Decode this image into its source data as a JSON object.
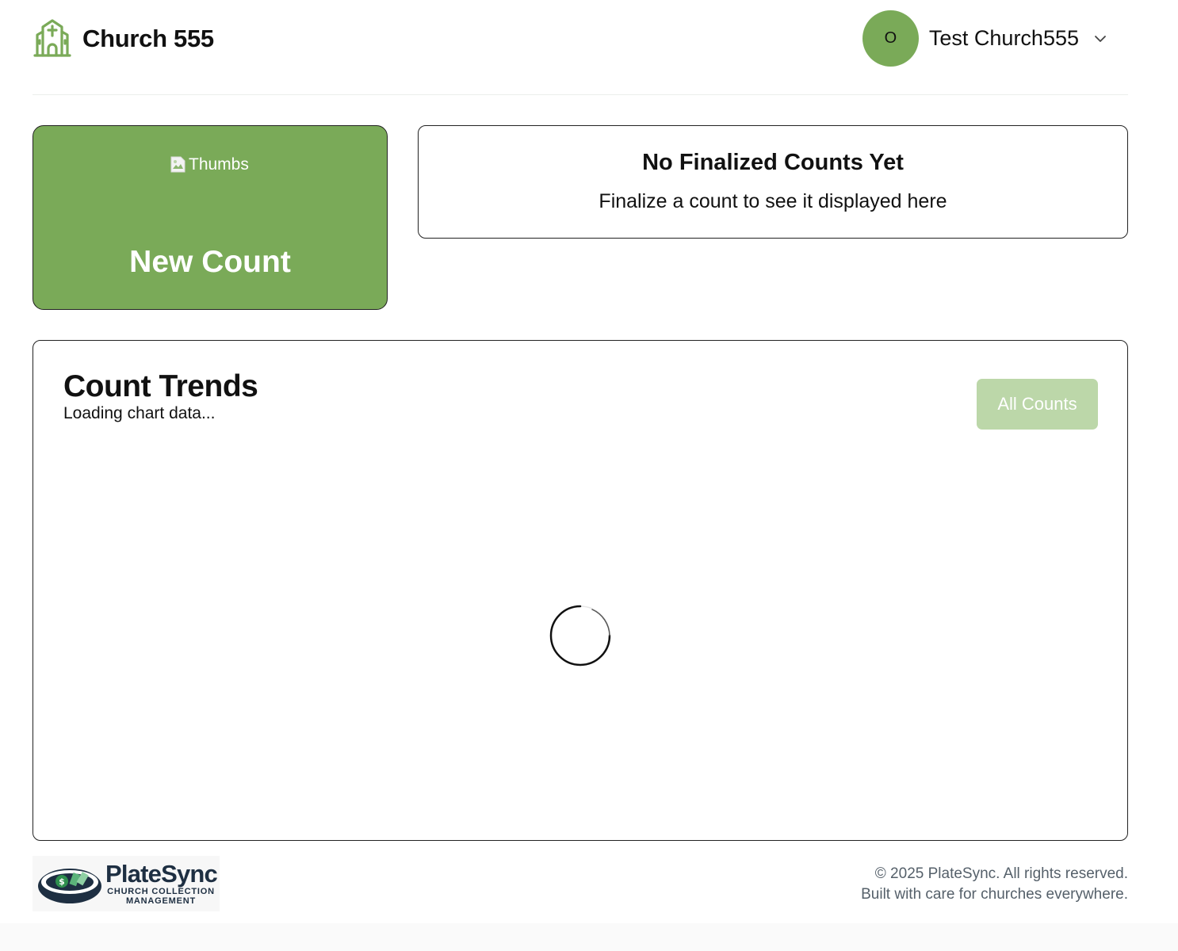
{
  "header": {
    "brand_title": "Church 555",
    "brand_icon": "church-icon",
    "user_initial": "O",
    "user_name": "Test Church555",
    "menu_icon": "chevron-down-icon"
  },
  "new_count_card": {
    "image_alt": "Thumbs",
    "label": "New Count"
  },
  "finalized_card": {
    "title": "No Finalized Counts Yet",
    "subtitle": "Finalize a count to see it displayed here"
  },
  "trends": {
    "title": "Count Trends",
    "status": "Loading chart data...",
    "all_counts_button": "All Counts",
    "spinner_icon": "loading-spinner-icon"
  },
  "footer": {
    "logo_name": "PlateSync",
    "logo_tagline_1": "CHURCH COLLECTION",
    "logo_tagline_2": "MANAGEMENT",
    "copyright": "© 2025 PlateSync. All rights reserved.",
    "tagline": "Built with care for churches everywhere."
  },
  "colors": {
    "brand_green": "#7aaa58",
    "button_disabled_green": "#bcd7a9",
    "footer_navy": "#1e2f42",
    "footer_text": "#55606a"
  }
}
